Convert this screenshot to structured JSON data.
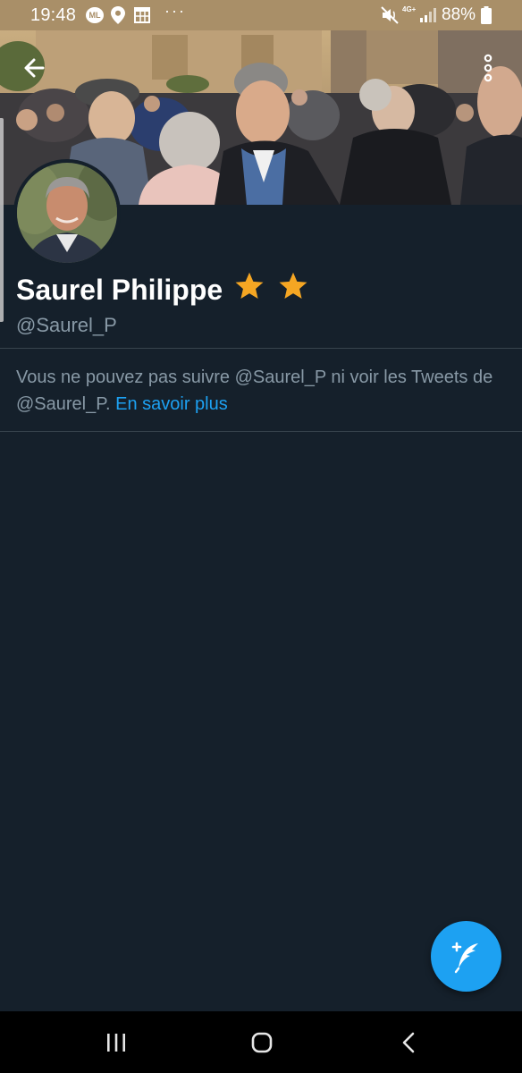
{
  "status_bar": {
    "time": "19:48",
    "carrier_badge": "ML",
    "overflow_dots": "···",
    "network_type": "4G+",
    "battery_percent": "88%",
    "icons": [
      "location-pin-icon",
      "calendar-icon",
      "mute-icon",
      "signal-icon",
      "battery-icon"
    ]
  },
  "header": {
    "back_icon": "arrow-left-icon",
    "more_icon": "more-vertical-icon"
  },
  "profile": {
    "name": "Saurel Philippe",
    "badges": [
      "star",
      "star"
    ],
    "handle": "@Saurel_P"
  },
  "notice": {
    "text": "Vous ne pouvez pas suivre @Saurel_P ni voir les Tweets de @Saurel_P.",
    "link_label": "En savoir plus"
  },
  "fab": {
    "icon": "compose-tweet-icon"
  },
  "nav": {
    "icons": [
      "recents-icon",
      "home-icon",
      "back-icon"
    ]
  },
  "colors": {
    "background": "#15202b",
    "accent": "#1da1f2",
    "secondary_text": "#8899a6",
    "divider": "#38444d",
    "status_bar": "#a98f68",
    "star": "#f5a623"
  }
}
